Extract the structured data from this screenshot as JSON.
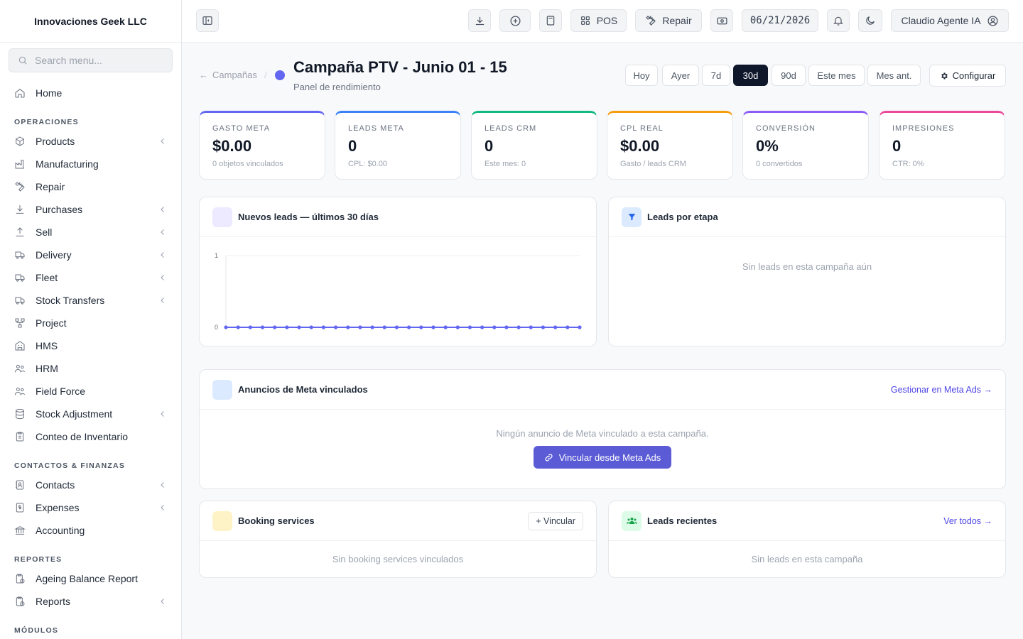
{
  "app": {
    "brand": "Innovaciones Geek LLC",
    "search_placeholder": "Search menu..."
  },
  "sidebar": {
    "home": "Home",
    "operaciones": {
      "title": "OPERACIONES",
      "items": [
        {
          "label": "Products",
          "icon": "box-icon",
          "expandable": true
        },
        {
          "label": "Manufacturing",
          "icon": "factory-icon",
          "expandable": false
        },
        {
          "label": "Repair",
          "icon": "wrench-icon",
          "expandable": false
        },
        {
          "label": "Purchases",
          "icon": "download-icon",
          "expandable": true
        },
        {
          "label": "Sell",
          "icon": "upload-icon",
          "expandable": true
        },
        {
          "label": "Delivery",
          "icon": "truck-icon",
          "expandable": true
        },
        {
          "label": "Fleet",
          "icon": "truck-icon",
          "expandable": true
        },
        {
          "label": "Stock Transfers",
          "icon": "truck-icon",
          "expandable": true
        },
        {
          "label": "Project",
          "icon": "sitemap-icon",
          "expandable": false
        },
        {
          "label": "HMS",
          "icon": "hotel-icon",
          "expandable": false
        },
        {
          "label": "HRM",
          "icon": "users-icon",
          "expandable": false
        },
        {
          "label": "Field Force",
          "icon": "users-icon",
          "expandable": false
        },
        {
          "label": "Stock Adjustment",
          "icon": "database-icon",
          "expandable": true
        },
        {
          "label": "Conteo de Inventario",
          "icon": "clipboard-icon",
          "expandable": false
        }
      ]
    },
    "contactos": {
      "title": "CONTACTOS & FINANZAS",
      "items": [
        {
          "label": "Contacts",
          "icon": "address-book-icon",
          "expandable": true
        },
        {
          "label": "Expenses",
          "icon": "dollar-file-icon",
          "expandable": true
        },
        {
          "label": "Accounting",
          "icon": "bank-icon",
          "expandable": false
        }
      ]
    },
    "reportes": {
      "title": "REPORTES",
      "items": [
        {
          "label": "Ageing Balance Report",
          "icon": "clipboard-clock-icon",
          "expandable": false
        },
        {
          "label": "Reports",
          "icon": "clipboard-clock-icon",
          "expandable": true
        }
      ]
    },
    "modulos_title": "MÓDULOS"
  },
  "topbar": {
    "pos_label": "POS",
    "repair_label": "Repair",
    "date": "06/21/2026",
    "user_name": "Claudio Agente IA"
  },
  "page": {
    "breadcrumb": "Campañas",
    "title": "Campaña PTV - Junio 01 - 15",
    "subtitle": "Panel de rendimiento",
    "status_color": "#6366f1",
    "ranges": [
      "Hoy",
      "Ayer",
      "7d",
      "30d",
      "90d",
      "Este mes",
      "Mes ant."
    ],
    "active_range": "30d",
    "config_label": "Configurar"
  },
  "kpis": [
    {
      "label": "GASTO META",
      "value": "$0.00",
      "sub": "0 objetos vinculados",
      "color": "#6366f1"
    },
    {
      "label": "LEADS META",
      "value": "0",
      "sub": "CPL: $0.00",
      "color": "#3b82f6"
    },
    {
      "label": "LEADS CRM",
      "value": "0",
      "sub": "Este mes: 0",
      "color": "#10b981"
    },
    {
      "label": "CPL REAL",
      "value": "$0.00",
      "sub": "Gasto / leads CRM",
      "color": "#f59e0b"
    },
    {
      "label": "CONVERSIÓN",
      "value": "0%",
      "sub": "0 convertidos",
      "color": "#8b5cf6"
    },
    {
      "label": "IMPRESIONES",
      "value": "0",
      "sub": "CTR: 0%",
      "color": "#ec4899"
    }
  ],
  "leads_chart": {
    "title": "Nuevos leads — últimos 30 días"
  },
  "chart_data": {
    "type": "line",
    "title": "",
    "xlabel": "",
    "ylabel": "",
    "ylim": [
      0,
      1
    ],
    "yticks": [
      "0",
      "1"
    ],
    "grid": true,
    "series": [
      {
        "values": [
          0,
          0,
          0,
          0,
          0,
          0,
          0,
          0,
          0,
          0,
          0,
          0,
          0,
          0,
          0,
          0,
          0,
          0,
          0,
          0,
          0,
          0,
          0,
          0,
          0,
          0,
          0,
          0,
          0,
          0
        ]
      }
    ],
    "color": "#6366f1"
  },
  "stage_card": {
    "title": "Leads por etapa",
    "empty": "Sin leads en esta campaña aún"
  },
  "ads_card": {
    "title": "Anuncios de Meta vinculados",
    "link": "Gestionar en Meta Ads →",
    "empty": "Ningún anuncio de Meta vinculado a esta campaña.",
    "button": "Vincular desde Meta Ads"
  },
  "booking_card": {
    "title": "Booking services",
    "button": "+ Vincular",
    "empty": "Sin booking services vinculados"
  },
  "recent_card": {
    "title": "Leads recientes",
    "link": "Ver todos →",
    "empty": "Sin leads en esta campaña"
  }
}
